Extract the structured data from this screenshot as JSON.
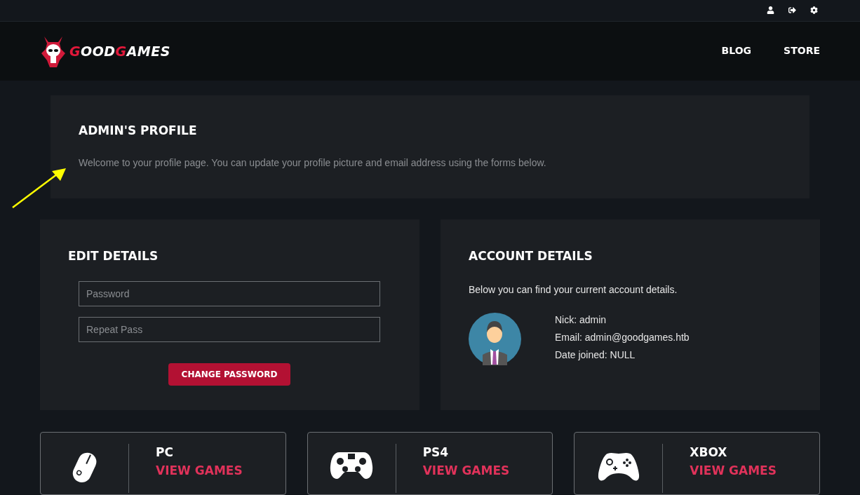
{
  "logo": {
    "parts": [
      {
        "text": "G",
        "accent": true
      },
      {
        "text": "OOD",
        "accent": false
      },
      {
        "text": "G",
        "accent": true
      },
      {
        "text": "AMES",
        "accent": false
      }
    ]
  },
  "nav": [
    {
      "label": "BLOG"
    },
    {
      "label": "STORE"
    }
  ],
  "profile": {
    "title": "ADMIN'S PROFILE",
    "text": "Welcome to your profile page. You can update your profile picture and email address using the forms below."
  },
  "edit_details": {
    "title": "EDIT DETAILS",
    "fields": [
      {
        "placeholder": "Password"
      },
      {
        "placeholder": "Repeat Pass"
      }
    ],
    "button": "CHANGE PASSWORD"
  },
  "account_details": {
    "title": "ACCOUNT DETAILS",
    "text": "Below you can find your current account details.",
    "lines": [
      "Nick: admin",
      "Email: admin@goodgames.htb",
      "Date joined: NULL"
    ]
  },
  "platforms": [
    {
      "kind": "mouse",
      "name": "PC",
      "link": "VIEW GAMES"
    },
    {
      "kind": "ps",
      "name": "PS4",
      "link": "VIEW GAMES"
    },
    {
      "kind": "xbox",
      "name": "XBOX",
      "link": "VIEW GAMES"
    }
  ]
}
